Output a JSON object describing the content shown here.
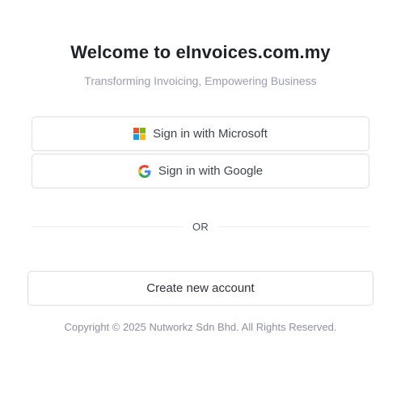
{
  "header": {
    "title": "Welcome to eInvoices.com.my",
    "subtitle": "Transforming Invoicing, Empowering Business"
  },
  "signin": {
    "microsoft_label": "Sign in with Microsoft",
    "google_label": "Sign in with Google",
    "microsoft_icon": "microsoft-logo-icon",
    "google_icon": "google-logo-icon",
    "microsoft_colors": [
      "#f25022",
      "#7fba00",
      "#00a4ef",
      "#ffb900"
    ],
    "google_colors": [
      "#4285f4",
      "#34a853",
      "#fbbc05",
      "#ea4335"
    ]
  },
  "divider": {
    "label": "OR"
  },
  "register": {
    "create_label": "Create new account"
  },
  "footer": {
    "copyright": "Copyright © 2025 Nutworkz Sdn Bhd. All Rights Reserved."
  }
}
